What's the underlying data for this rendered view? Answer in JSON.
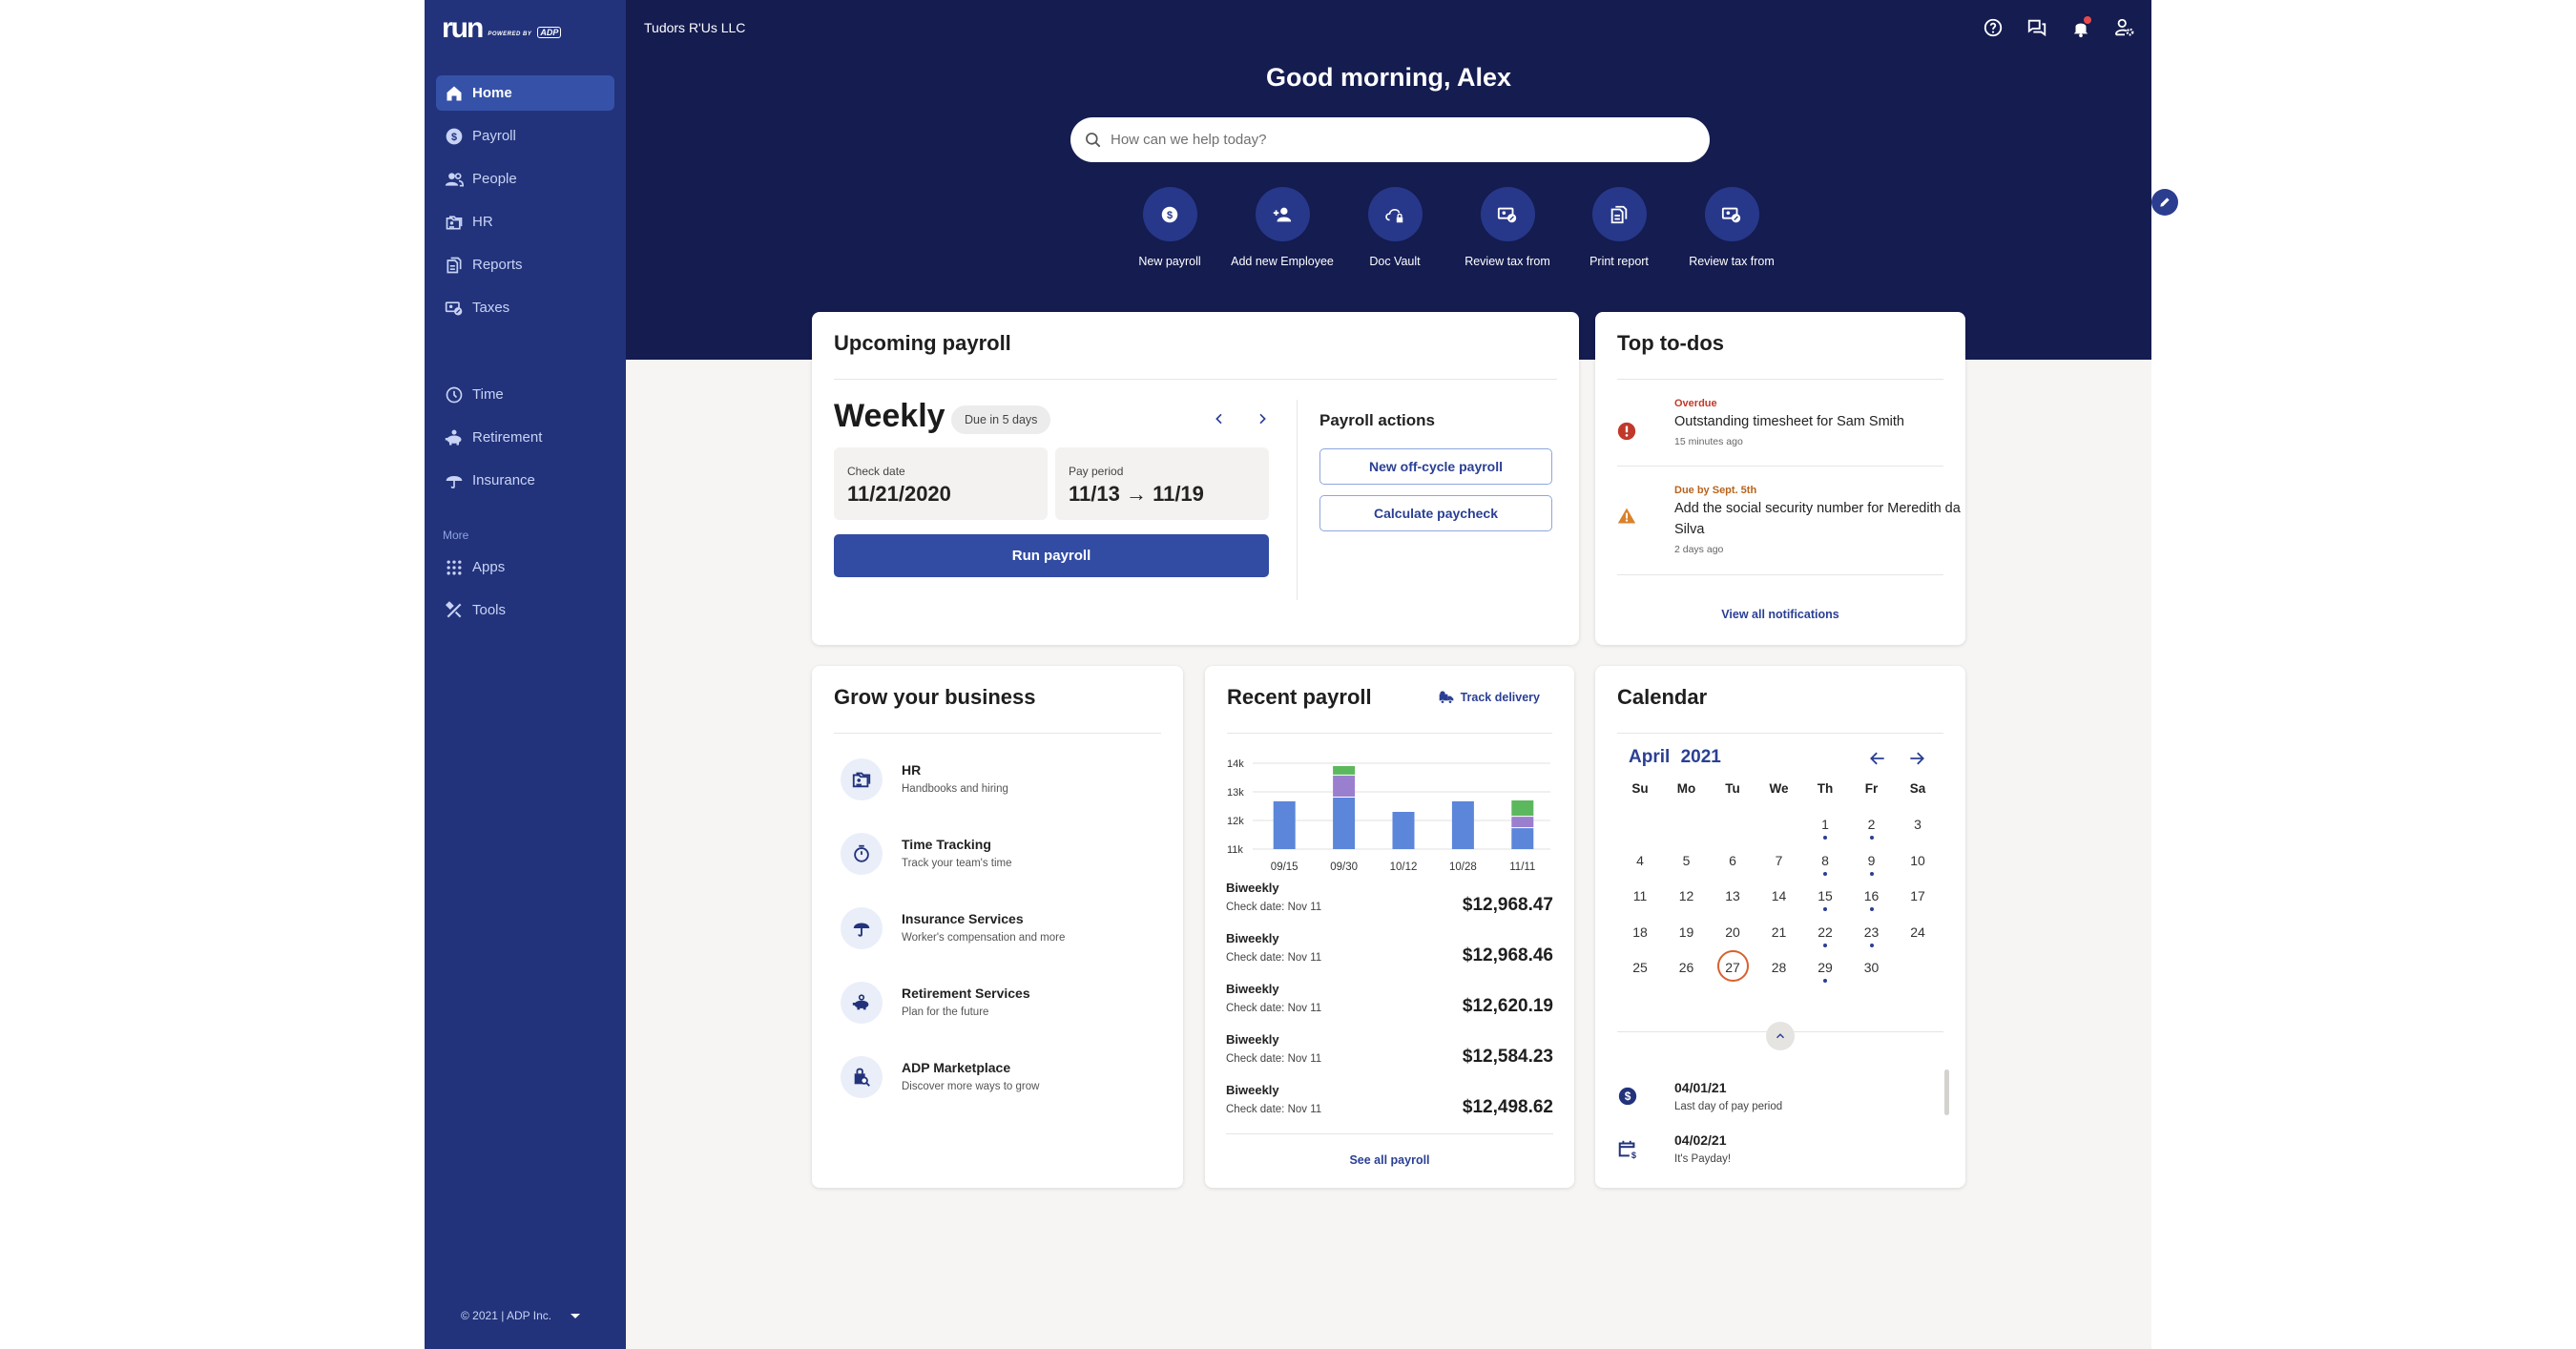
{
  "app": {
    "logo_text": "run",
    "powered_by": "POWERED BY",
    "brand": "ADP",
    "company": "Tudors R'Us LLC",
    "colors": {
      "sidebar": "#22337b",
      "header": "#141c50",
      "accent": "#324ca3",
      "link": "#2a3f94",
      "overdue": "#c0392b",
      "warning": "#d9822b",
      "today_ring": "#d8602d"
    }
  },
  "sidebar": {
    "items": [
      {
        "label": "Home",
        "icon": "home-icon",
        "active": true
      },
      {
        "label": "Payroll",
        "icon": "dollar-circle-icon"
      },
      {
        "label": "People",
        "icon": "people-icon"
      },
      {
        "label": "HR",
        "icon": "hr-folder-icon"
      },
      {
        "label": "Reports",
        "icon": "reports-icon"
      },
      {
        "label": "Taxes",
        "icon": "taxes-icon"
      },
      {
        "label": "Time",
        "icon": "clock-icon"
      },
      {
        "label": "Retirement",
        "icon": "piggy-bank-icon"
      },
      {
        "label": "Insurance",
        "icon": "umbrella-icon"
      }
    ],
    "more_label": "More",
    "more_items": [
      {
        "label": "Apps",
        "icon": "apps-grid-icon"
      },
      {
        "label": "Tools",
        "icon": "tools-icon"
      }
    ],
    "footer": "© 2021 | ADP Inc."
  },
  "header": {
    "greeting": "Good morning, Alex",
    "search_placeholder": "How can we help today?",
    "icons": [
      "help-icon",
      "chat-icon",
      "bell-icon",
      "user-settings-icon"
    ],
    "quick_actions": [
      {
        "label": "New payroll",
        "icon": "dollar-circle-icon"
      },
      {
        "label": "Add new Employee",
        "icon": "add-person-icon"
      },
      {
        "label": "Doc Vault",
        "icon": "cloud-lock-icon"
      },
      {
        "label": "Review tax from",
        "icon": "taxes-icon"
      },
      {
        "label": "Print report",
        "icon": "reports-icon"
      },
      {
        "label": "Review tax from",
        "icon": "taxes-icon"
      }
    ]
  },
  "upcoming_payroll": {
    "title": "Upcoming payroll",
    "frequency": "Weekly",
    "due": "Due in 5 days",
    "check_date_label": "Check date",
    "check_date": "11/21/2020",
    "pay_period_label": "Pay period",
    "pay_period": "11/13 → 11/19",
    "run_button": "Run payroll",
    "actions_title": "Payroll actions",
    "actions": [
      "New off-cycle payroll",
      "Calculate paycheck"
    ]
  },
  "todos": {
    "title": "Top to-dos",
    "items": [
      {
        "tag": "Overdue",
        "text": "Outstanding timesheet for Sam Smith",
        "ago": "15 minutes ago",
        "severity": "error"
      },
      {
        "tag": "Due by Sept. 5th",
        "text": "Add the social security number for Meredith da Silva",
        "ago": "2 days ago",
        "severity": "warning"
      }
    ],
    "view_all": "View all notifications"
  },
  "grow": {
    "title": "Grow your business",
    "items": [
      {
        "title": "HR",
        "subtitle": "Handbooks and hiring",
        "icon": "hr-folder-icon"
      },
      {
        "title": "Time Tracking",
        "subtitle": "Track your team's time",
        "icon": "stopwatch-icon"
      },
      {
        "title": "Insurance Services",
        "subtitle": "Worker's compensation and more",
        "icon": "umbrella-icon"
      },
      {
        "title": "Retirement Services",
        "subtitle": "Plan for the future",
        "icon": "piggy-bank-icon"
      },
      {
        "title": "ADP Marketplace",
        "subtitle": "Discover more ways to grow",
        "icon": "marketplace-bag-icon"
      }
    ]
  },
  "recent_payroll": {
    "title": "Recent payroll",
    "track_delivery": "Track delivery",
    "rows": [
      {
        "type": "Biweekly",
        "check_date": "Check date: Nov 11",
        "amount": "$12,968.47"
      },
      {
        "type": "Biweekly",
        "check_date": "Check date: Nov 11",
        "amount": "$12,968.46"
      },
      {
        "type": "Biweekly",
        "check_date": "Check date: Nov 11",
        "amount": "$12,620.19"
      },
      {
        "type": "Biweekly",
        "check_date": "Check date: Nov 11",
        "amount": "$12,584.23"
      },
      {
        "type": "Biweekly",
        "check_date": "Check date: Nov 11",
        "amount": "$12,498.62"
      }
    ],
    "see_all": "See all payroll"
  },
  "chart_data": {
    "type": "bar",
    "stacked": true,
    "title": "",
    "xlabel": "",
    "ylabel": "",
    "categories": [
      "09/15",
      "09/30",
      "10/12",
      "10/28",
      "11/11"
    ],
    "ylim": [
      11,
      14
    ],
    "yticks": [
      11,
      12,
      13,
      14
    ],
    "ytick_labels": [
      "11k",
      "12k",
      "13k",
      "14k"
    ],
    "grid": true,
    "legend": "none",
    "unit": "thousands USD (cumulative stack tops)",
    "series": [
      {
        "name": "base",
        "color": "#5b86d9",
        "values": [
          12.67,
          12.8,
          12.3,
          12.67,
          11.73
        ]
      },
      {
        "name": "segment-2",
        "color": "#9b7fcf",
        "values": [
          0,
          0.77,
          0,
          0,
          0.4
        ]
      },
      {
        "name": "segment-3",
        "color": "#5cb85c",
        "values": [
          0,
          0.33,
          0,
          0,
          0.57
        ]
      }
    ]
  },
  "calendar": {
    "title": "Calendar",
    "month": "April",
    "year": "2021",
    "weekdays": [
      "Su",
      "Mo",
      "Tu",
      "We",
      "Th",
      "Fr",
      "Sa"
    ],
    "first_weekday_index": 4,
    "days_in_month": 30,
    "today": 27,
    "event_days": [
      1,
      2,
      8,
      9,
      15,
      16,
      22,
      23,
      29
    ],
    "events": [
      {
        "date": "04/01/21",
        "text": "Last day of pay period",
        "icon": "dollar-circle-icon"
      },
      {
        "date": "04/02/21",
        "text": "It's Payday!",
        "icon": "calendar-dollar-icon"
      }
    ]
  }
}
